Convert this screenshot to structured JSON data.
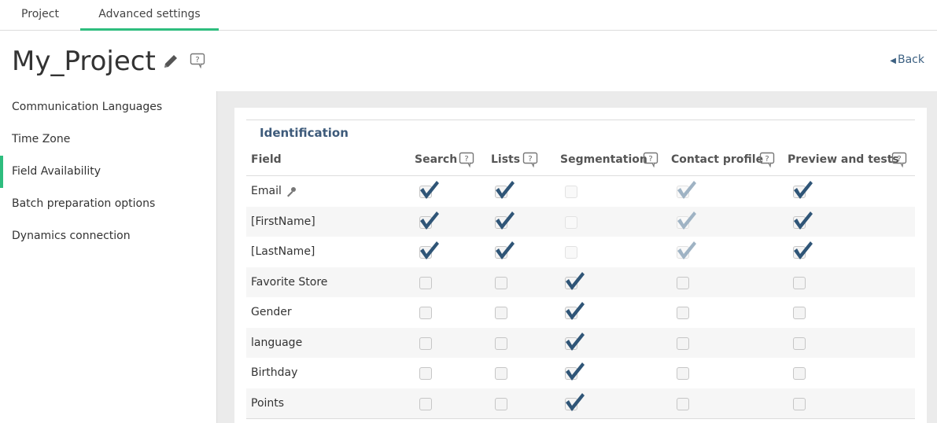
{
  "tabs": [
    {
      "label": "Project"
    },
    {
      "label": "Advanced settings"
    }
  ],
  "header": {
    "title": "My_Project",
    "back_label": "Back"
  },
  "sidebar": {
    "items": [
      {
        "label": "Communication Languages"
      },
      {
        "label": "Time Zone"
      },
      {
        "label": "Field Availability",
        "active": true
      },
      {
        "label": "Batch preparation options"
      },
      {
        "label": "Dynamics connection"
      }
    ]
  },
  "table": {
    "section_title": "Identification",
    "columns": [
      "Field",
      "Search",
      "Lists",
      "Segmentation",
      "Contact profile",
      "Preview and tests"
    ],
    "rows": [
      {
        "field": "Email",
        "key_icon": true,
        "values": [
          "checked",
          "checked",
          "disabled",
          "checked-disabled",
          "checked"
        ]
      },
      {
        "field": "[FirstName]",
        "values": [
          "checked",
          "checked",
          "disabled",
          "checked-disabled",
          "checked"
        ]
      },
      {
        "field": "[LastName]",
        "values": [
          "checked",
          "checked",
          "disabled",
          "checked-disabled",
          "checked"
        ]
      },
      {
        "field": "Favorite Store",
        "values": [
          "unchecked",
          "unchecked",
          "checked",
          "unchecked",
          "unchecked"
        ]
      },
      {
        "field": "Gender",
        "values": [
          "unchecked",
          "unchecked",
          "checked",
          "unchecked",
          "unchecked"
        ]
      },
      {
        "field": "language",
        "values": [
          "unchecked",
          "unchecked",
          "checked",
          "unchecked",
          "unchecked"
        ]
      },
      {
        "field": "Birthday",
        "values": [
          "unchecked",
          "unchecked",
          "checked",
          "unchecked",
          "unchecked"
        ]
      },
      {
        "field": "Points",
        "values": [
          "unchecked",
          "unchecked",
          "checked",
          "unchecked",
          "unchecked"
        ]
      }
    ]
  },
  "colors": {
    "accent": "#2ebd7e",
    "check": "#2f5577",
    "check_disabled": "#9fb3c4",
    "link": "#3d6182"
  }
}
